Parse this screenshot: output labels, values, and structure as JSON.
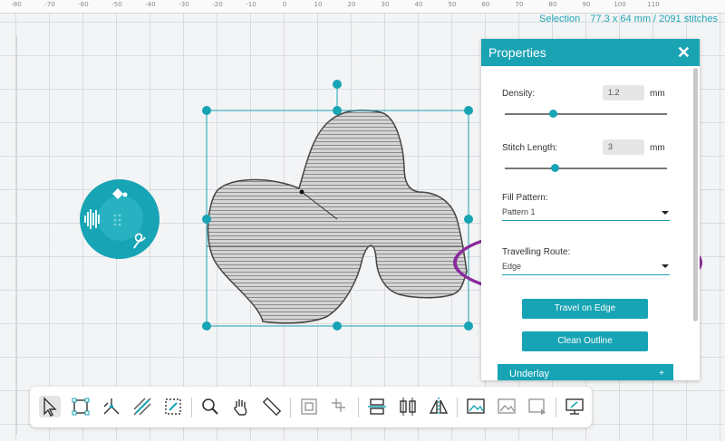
{
  "ruler": {
    "ticks": [
      "-80",
      "-70",
      "-60",
      "-50",
      "-40",
      "-30",
      "-20",
      "-10",
      "0",
      "10",
      "20",
      "30",
      "40",
      "50",
      "60",
      "70",
      "80",
      "90",
      "100",
      "110"
    ]
  },
  "selection": {
    "label": "Selection",
    "value": "77.3 x 64 mm / 2091 stitches"
  },
  "properties": {
    "title": "Properties",
    "close": "✕",
    "density": {
      "label": "Density:",
      "value": "1.2",
      "unit": "mm",
      "slider_fraction": 0.3
    },
    "stitch_length": {
      "label": "Stitch Length:",
      "value": "3",
      "unit": "mm",
      "slider_fraction": 0.31
    },
    "fill_pattern": {
      "label": "Fill Pattern:",
      "value": "Pattern 1"
    },
    "travelling_route": {
      "label": "Travelling Route:",
      "value": "Edge"
    },
    "travel_on_edge_button": "Travel on Edge",
    "clean_outline_button": "Clean Outline",
    "underlay": {
      "label": "Underlay",
      "toggle": "+"
    }
  },
  "colors": {
    "accent": "#19a3b3",
    "annotation": "#8a2a9c"
  },
  "toolbar": {
    "tools": [
      "select-icon",
      "node-edit-icon",
      "pen-tool-icon",
      "fill-tool-icon",
      "applique-icon",
      "zoom-icon",
      "pan-hand-icon",
      "measure-ruler-icon",
      "group-icon",
      "ungroup-icon",
      "align-horizontal-icon",
      "align-vertical-icon",
      "mirror-icon",
      "image-icon",
      "image-trace-icon",
      "image-edit-icon",
      "screen-settings-icon"
    ]
  }
}
